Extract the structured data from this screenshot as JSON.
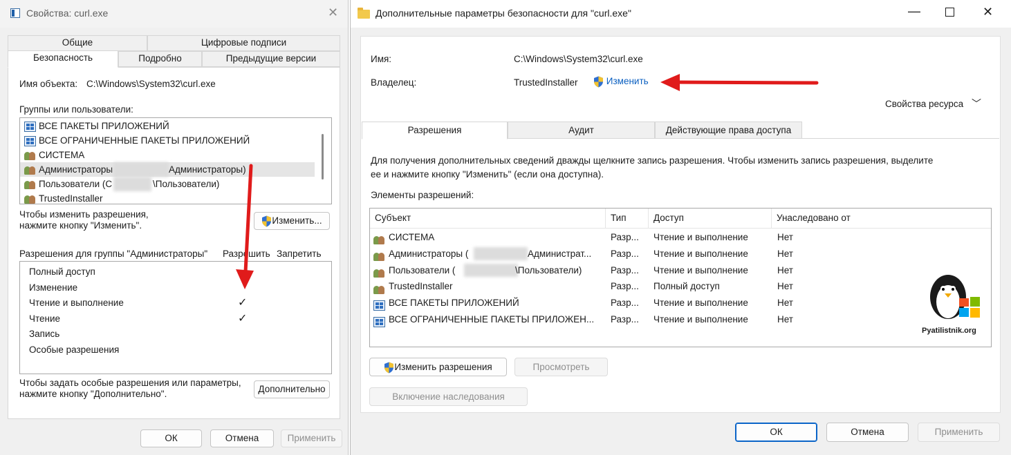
{
  "props_window": {
    "title": "Свойства: curl.exe",
    "tabs_row1": [
      "Общие",
      "Цифровые подписи"
    ],
    "tabs_row2": [
      "Безопасность",
      "Подробно",
      "Предыдущие версии"
    ],
    "object_name_label": "Имя объекта:",
    "object_name_value": "C:\\Windows\\System32\\curl.exe",
    "groups_label": "Группы или пользователи:",
    "groups": [
      {
        "name": "ВСЕ ПАКЕТЫ ПРИЛОЖЕНИЙ",
        "icon": "package-icon"
      },
      {
        "name": "ВСЕ ОГРАНИЧЕННЫЕ ПАКЕТЫ ПРИЛОЖЕНИЙ",
        "icon": "package-icon"
      },
      {
        "name": "СИСТЕМА",
        "icon": "users-icon"
      },
      {
        "name": "Администраторы",
        "suffix": "Администраторы)",
        "icon": "users-icon"
      },
      {
        "name": "Пользователи (С",
        "suffix": "\\Пользователи)",
        "icon": "users-icon"
      },
      {
        "name": "TrustedInstaller",
        "icon": "users-icon"
      }
    ],
    "change_hint": "Чтобы изменить разрешения,\nнажмите кнопку \"Изменить\".",
    "change_button": "Изменить...",
    "perm_header": "Разрешения для группы \"Администраторы\"",
    "allow_label": "Разрешить",
    "deny_label": "Запретить",
    "permissions": [
      {
        "name": "Полный доступ",
        "allow": false
      },
      {
        "name": "Изменение",
        "allow": false
      },
      {
        "name": "Чтение и выполнение",
        "allow": true
      },
      {
        "name": "Чтение",
        "allow": true
      },
      {
        "name": "Запись",
        "allow": false
      },
      {
        "name": "Особые разрешения",
        "allow": false
      }
    ],
    "check_mark": "✓",
    "advanced_hint": "Чтобы задать особые разрешения или параметры,\nнажмите кнопку \"Дополнительно\".",
    "advanced_button": "Дополнительно",
    "ok": "ОК",
    "cancel": "Отмена",
    "apply": "Применить"
  },
  "adv_window": {
    "title": "Дополнительные параметры безопасности  для \"curl.exe\"",
    "name_label": "Имя:",
    "name_value": "C:\\Windows\\System32\\curl.exe",
    "owner_label": "Владелец:",
    "owner_value": "TrustedInstaller",
    "owner_change": "Изменить",
    "resource_props": "Свойства ресурса",
    "tabs": [
      "Разрешения",
      "Аудит",
      "Действующие права доступа"
    ],
    "info_text": "Для получения дополнительных сведений дважды щелкните запись разрешения. Чтобы изменить запись разрешения, выделите\nее и нажмите кнопку \"Изменить\" (если она доступна).",
    "entries_label": "Элементы разрешений:",
    "columns": [
      "Субъект",
      "Тип",
      "Доступ",
      "Унаследовано от"
    ],
    "entries": [
      {
        "subject": "СИСТЕМА",
        "type": "Разр...",
        "access": "Чтение и выполнение",
        "inherited": "Нет",
        "icon": "users-icon"
      },
      {
        "subject": "Администраторы (",
        "subject_tail": "Администрат...",
        "type": "Разр...",
        "access": "Чтение и выполнение",
        "inherited": "Нет",
        "icon": "users-icon"
      },
      {
        "subject": "Пользователи (",
        "subject_tail": "\\Пользователи)",
        "type": "Разр...",
        "access": "Чтение и выполнение",
        "inherited": "Нет",
        "icon": "users-icon"
      },
      {
        "subject": "TrustedInstaller",
        "type": "Разр...",
        "access": "Полный доступ",
        "inherited": "Нет",
        "icon": "users-icon"
      },
      {
        "subject": "ВСЕ ПАКЕТЫ ПРИЛОЖЕНИЙ",
        "type": "Разр...",
        "access": "Чтение и выполнение",
        "inherited": "Нет",
        "icon": "package-icon"
      },
      {
        "subject": "ВСЕ ОГРАНИЧЕННЫЕ ПАКЕТЫ ПРИЛОЖЕН...",
        "type": "Разр...",
        "access": "Чтение и выполнение",
        "inherited": "Нет",
        "icon": "package-icon"
      }
    ],
    "change_perms_button": "Изменить разрешения",
    "view_button": "Просмотреть",
    "inherit_button": "Включение наследования",
    "ok": "ОК",
    "cancel": "Отмена",
    "apply": "Применить"
  },
  "watermark": "Pyatilistnik.org",
  "colors": {
    "accent": "#0a64c8",
    "annotation_arrow": "#e01b1b",
    "link": "#0a5fc0"
  }
}
